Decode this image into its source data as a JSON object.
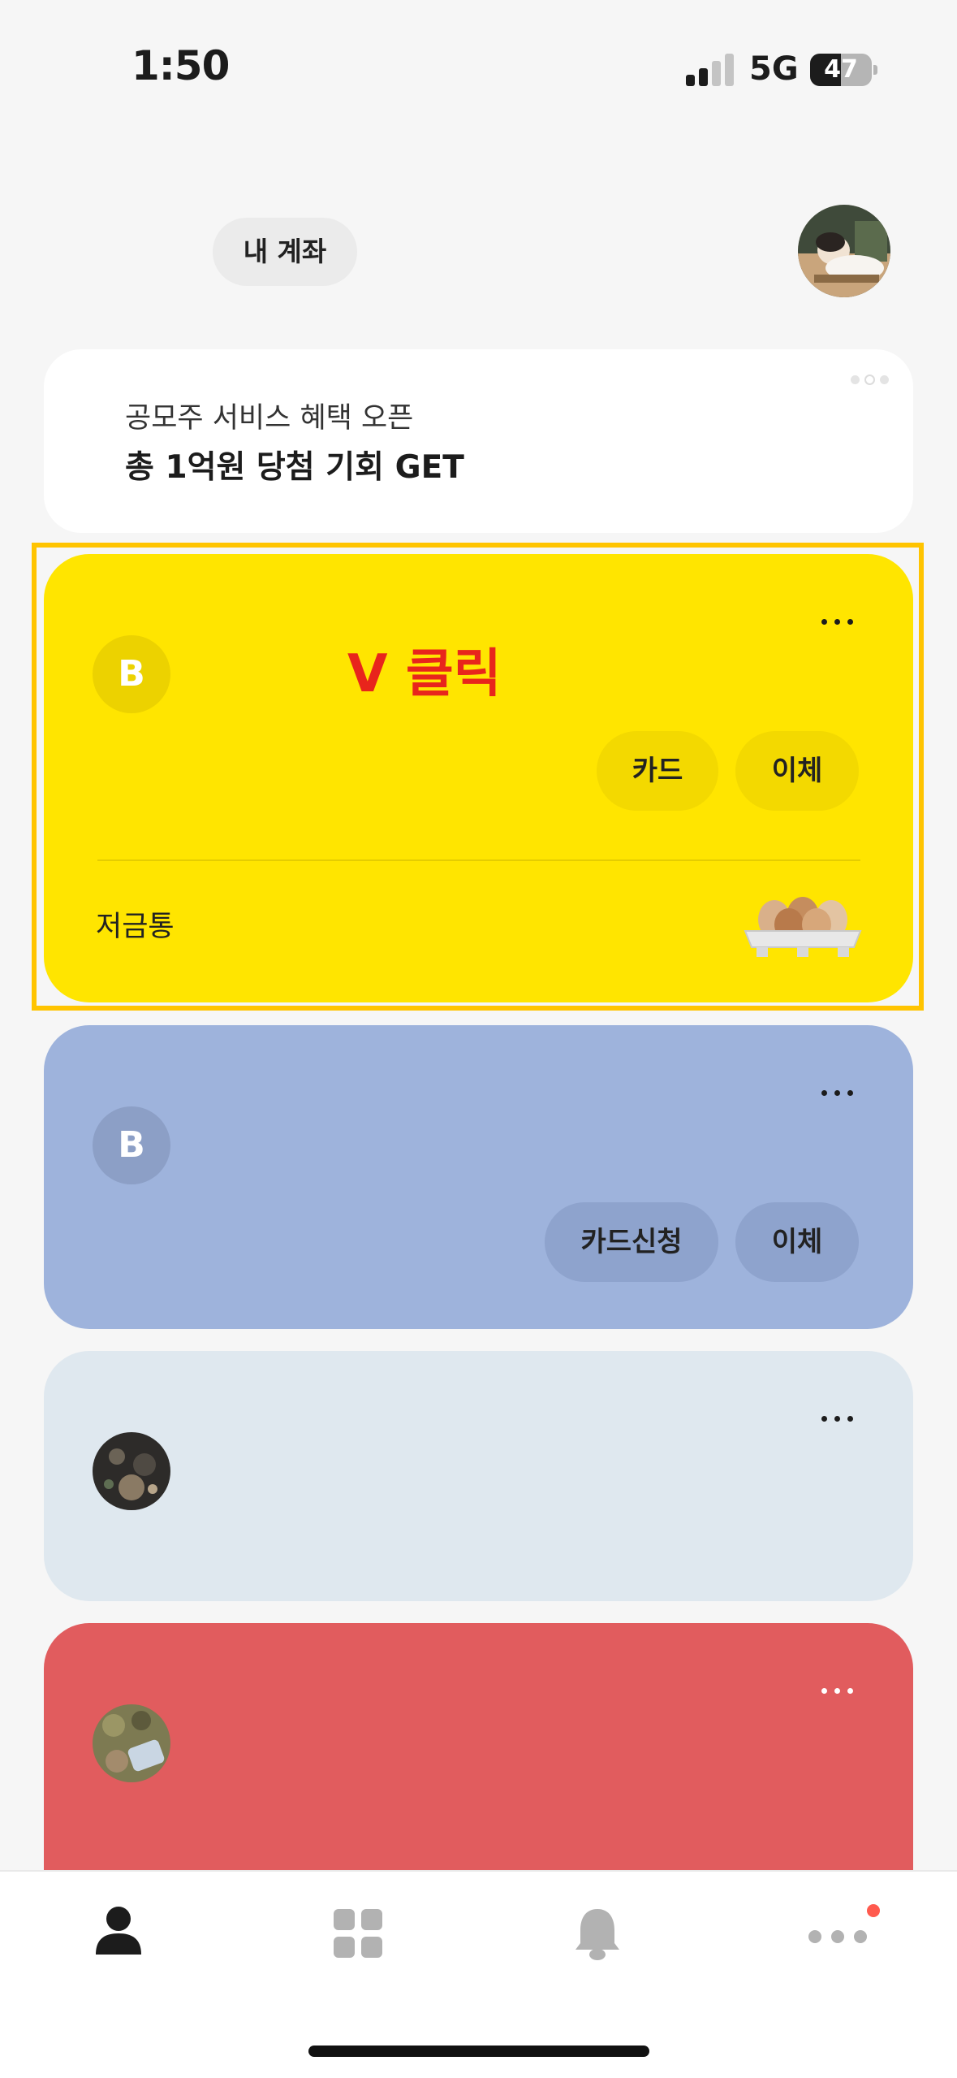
{
  "status_bar": {
    "time": "1:50",
    "network": "5G",
    "battery": "47"
  },
  "header": {
    "account_button": "내 계좌",
    "profile_icon": "user-profile-photo"
  },
  "promo": {
    "subtitle": "공모주 서비스 혜택 오픈",
    "title": "총 1억원 당첨 기회 GET",
    "page_dots": 3,
    "active_dot": 2
  },
  "cards": [
    {
      "color": "#ffe500",
      "icon": "B",
      "buttons": [
        "카드",
        "이체"
      ],
      "piggy_label": "저금통",
      "piggy_icon": "eggs-in-carton-icon"
    },
    {
      "color": "#9eb3dc",
      "icon": "B",
      "buttons": [
        "카드신청",
        "이체"
      ]
    },
    {
      "color": "#dfe8ef",
      "icon": "photo-avatar"
    },
    {
      "color": "#e15c5e",
      "icon": "photo-avatar"
    }
  ],
  "annotation": {
    "text": "V 클릭",
    "color": "#e8251c",
    "box_color": "#ffc400"
  },
  "bottom_nav": {
    "items": [
      "person-icon",
      "grid-icon",
      "bell-icon",
      "more-icon"
    ],
    "active": "person-icon",
    "badge_color": "#ff5a4e"
  }
}
